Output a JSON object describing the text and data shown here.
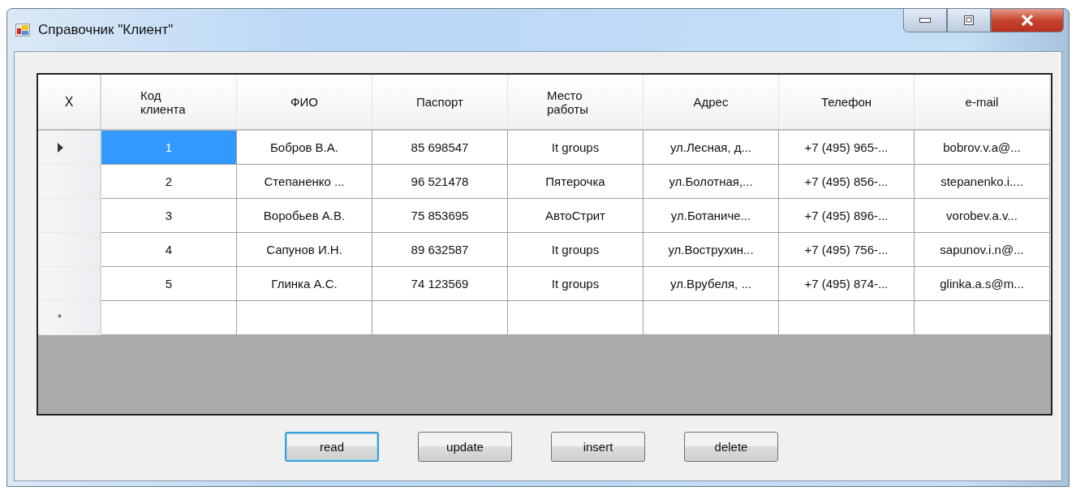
{
  "window": {
    "title": "Справочник \"Клиент\""
  },
  "grid": {
    "corner": "X",
    "columns": [
      "Код клиента",
      "ФИО",
      "Паспорт",
      "Место работы",
      "Адрес",
      "Телефон",
      "e-mail"
    ],
    "rows": [
      {
        "current": true,
        "cells": [
          {
            "text": "1",
            "selected": true
          },
          {
            "text": "Бобров В.А.",
            "selected": false
          },
          {
            "text": "85 698547",
            "selected": false
          },
          {
            "text": "It groups",
            "selected": false
          },
          {
            "text": "ул.Лесная, д...",
            "selected": false
          },
          {
            "text": "+7 (495) 965-...",
            "selected": false
          },
          {
            "text": "bobrov.v.a@...",
            "selected": false
          }
        ]
      },
      {
        "current": false,
        "cells": [
          {
            "text": "2",
            "selected": false
          },
          {
            "text": "Степаненко ...",
            "selected": false
          },
          {
            "text": "96 521478",
            "selected": false
          },
          {
            "text": "Пятерочка",
            "selected": false
          },
          {
            "text": "ул.Болотная,...",
            "selected": false
          },
          {
            "text": "+7 (495) 856-...",
            "selected": false
          },
          {
            "text": "stepanenko.i....",
            "selected": false
          }
        ]
      },
      {
        "current": false,
        "cells": [
          {
            "text": "3",
            "selected": false
          },
          {
            "text": "Воробьев А.В.",
            "selected": false
          },
          {
            "text": "75 853695",
            "selected": false
          },
          {
            "text": "АвтоСтрит",
            "selected": false
          },
          {
            "text": "ул.Ботаниче...",
            "selected": false
          },
          {
            "text": "+7 (495) 896-...",
            "selected": false
          },
          {
            "text": "vorobev.a.v...",
            "selected": false
          }
        ]
      },
      {
        "current": false,
        "cells": [
          {
            "text": "4",
            "selected": false
          },
          {
            "text": "Сапунов И.Н.",
            "selected": false
          },
          {
            "text": "89 632587",
            "selected": false
          },
          {
            "text": "It groups",
            "selected": false
          },
          {
            "text": "ул.Вострухин...",
            "selected": false
          },
          {
            "text": "+7 (495) 756-...",
            "selected": false
          },
          {
            "text": "sapunov.i.n@...",
            "selected": false
          }
        ]
      },
      {
        "current": false,
        "cells": [
          {
            "text": "5",
            "selected": false
          },
          {
            "text": "Глинка А.С.",
            "selected": false
          },
          {
            "text": "74 123569",
            "selected": false
          },
          {
            "text": "It groups",
            "selected": false
          },
          {
            "text": "ул.Врубеля, ...",
            "selected": false
          },
          {
            "text": "+7 (495) 874-...",
            "selected": false
          },
          {
            "text": "glinka.a.s@m...",
            "selected": false
          }
        ]
      }
    ],
    "new_row_marker": "*"
  },
  "buttons": [
    {
      "label": "read",
      "focused": true
    },
    {
      "label": "update",
      "focused": false
    },
    {
      "label": "insert",
      "focused": false
    },
    {
      "label": "delete",
      "focused": false
    }
  ]
}
